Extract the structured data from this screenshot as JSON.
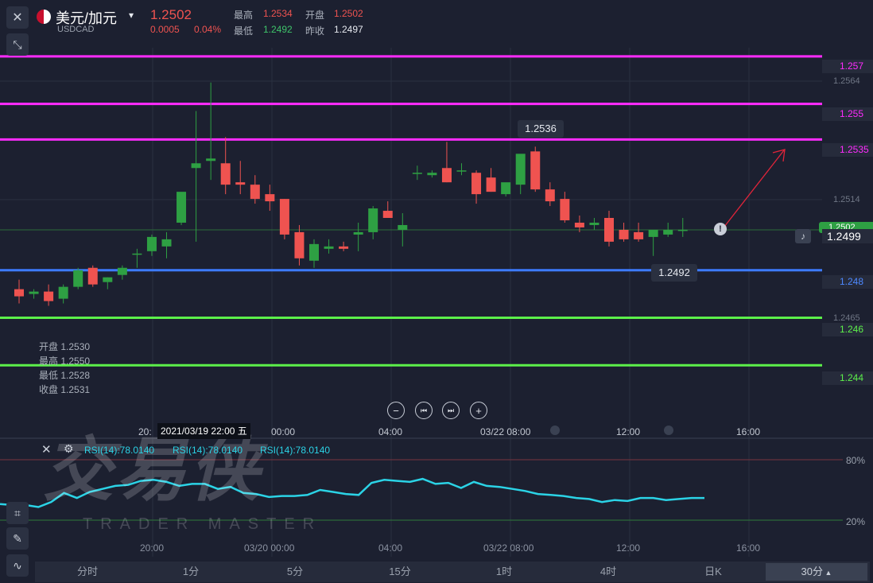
{
  "header": {
    "symbol": "美元/加元",
    "code": "USDCAD",
    "price": "1.2502",
    "change": "0.0005",
    "change_pct": "0.04%",
    "high_label": "最高",
    "high_value": "1.2534",
    "low_label": "最低",
    "low_value": "1.2492",
    "open_label": "开盘",
    "open_value": "1.2502",
    "prev_close_label": "昨收",
    "prev_close_value": "1.2497"
  },
  "levels": [
    {
      "label": "1.257",
      "color": "#ff2bff"
    },
    {
      "label": "1.255",
      "color": "#ff2bff"
    },
    {
      "label": "1.2535",
      "color": "#ff2bff"
    },
    {
      "label": "1.248",
      "color": "#3d7bff"
    },
    {
      "label": "1.246",
      "color": "#5cf04a"
    },
    {
      "label": "1.244",
      "color": "#5cf04a"
    }
  ],
  "price_axis": [
    "1.2564",
    "1.2514",
    "1.2465"
  ],
  "current_price_tag": "1.2502",
  "current_price_alert": "1.2499",
  "annotations": {
    "high_tip": "1.2536",
    "low_tip": "1.2492"
  },
  "ohlc_info": {
    "open": "开盘 1.2530",
    "high": "最高 1.2550",
    "low": "最低 1.2528",
    "close": "收盘 1.2531"
  },
  "crosshair_time": "2021/03/19 22:00 五",
  "time_axis": [
    "20:00",
    "03/20 00:00",
    "04:00",
    "03/22 08:00",
    "12:00",
    "16:00"
  ],
  "time_axis_main_partial": {
    "left": "20:",
    "mid_tail": "00:00"
  },
  "rsi": {
    "labels": [
      "RSI(14):78.0140",
      "RSI(14):78.0140",
      "RSI(14):78.0140"
    ],
    "level_high": "80%",
    "level_low": "20%",
    "values": [
      36,
      35,
      35,
      33,
      38,
      47,
      42,
      48,
      51,
      54,
      55,
      59,
      60,
      58,
      54,
      56,
      56,
      51,
      53,
      47,
      46,
      43,
      44,
      44,
      45,
      50,
      48,
      46,
      45,
      57,
      60,
      59,
      58,
      61,
      56,
      57,
      52,
      58,
      54,
      53,
      51,
      49,
      46,
      45,
      44,
      42,
      41,
      38,
      40,
      39,
      42,
      42,
      40,
      41,
      42,
      42
    ]
  },
  "watermark": {
    "text": "TRADER MASTER"
  },
  "tabs": [
    "分时",
    "1分",
    "5分",
    "15分",
    "1时",
    "4时",
    "日K",
    "30分"
  ],
  "active_tab_index": 7,
  "chart_data": {
    "type": "candlestick",
    "symbol": "USDCAD",
    "candles": [
      {
        "o": 1.2472,
        "h": 1.2476,
        "l": 1.2466,
        "c": 1.2469
      },
      {
        "o": 1.247,
        "h": 1.2472,
        "l": 1.2468,
        "c": 1.2471
      },
      {
        "o": 1.2471,
        "h": 1.2474,
        "l": 1.2465,
        "c": 1.2467
      },
      {
        "o": 1.2468,
        "h": 1.2474,
        "l": 1.2466,
        "c": 1.2473
      },
      {
        "o": 1.2473,
        "h": 1.2481,
        "l": 1.2472,
        "c": 1.248
      },
      {
        "o": 1.2481,
        "h": 1.2482,
        "l": 1.2473,
        "c": 1.2474
      },
      {
        "o": 1.2475,
        "h": 1.2477,
        "l": 1.2472,
        "c": 1.2477
      },
      {
        "o": 1.2478,
        "h": 1.2482,
        "l": 1.2476,
        "c": 1.2481
      },
      {
        "o": 1.2487,
        "h": 1.2489,
        "l": 1.2481,
        "c": 1.2487
      },
      {
        "o": 1.2488,
        "h": 1.2495,
        "l": 1.2486,
        "c": 1.2494
      },
      {
        "o": 1.249,
        "h": 1.2496,
        "l": 1.2485,
        "c": 1.2493
      },
      {
        "o": 1.25,
        "h": 1.2507,
        "l": 1.2499,
        "c": 1.2513
      },
      {
        "o": 1.2523,
        "h": 1.2547,
        "l": 1.2492,
        "c": 1.2525
      },
      {
        "o": 1.2526,
        "h": 1.2559,
        "l": 1.2518,
        "c": 1.2527
      },
      {
        "o": 1.2525,
        "h": 1.2536,
        "l": 1.2512,
        "c": 1.2516
      },
      {
        "o": 1.2517,
        "h": 1.2526,
        "l": 1.2512,
        "c": 1.2516
      },
      {
        "o": 1.2516,
        "h": 1.252,
        "l": 1.2508,
        "c": 1.251
      },
      {
        "o": 1.2512,
        "h": 1.2516,
        "l": 1.2505,
        "c": 1.2509
      },
      {
        "o": 1.251,
        "h": 1.251,
        "l": 1.2493,
        "c": 1.2495
      },
      {
        "o": 1.2496,
        "h": 1.2499,
        "l": 1.2482,
        "c": 1.2485
      },
      {
        "o": 1.2484,
        "h": 1.2493,
        "l": 1.2481,
        "c": 1.2491
      },
      {
        "o": 1.2489,
        "h": 1.2493,
        "l": 1.2487,
        "c": 1.249
      },
      {
        "o": 1.249,
        "h": 1.2492,
        "l": 1.2488,
        "c": 1.2489
      },
      {
        "o": 1.2495,
        "h": 1.25,
        "l": 1.2488,
        "c": 1.2496
      },
      {
        "o": 1.2496,
        "h": 1.2507,
        "l": 1.2493,
        "c": 1.2506
      },
      {
        "o": 1.2505,
        "h": 1.2509,
        "l": 1.2503,
        "c": 1.2502
      },
      {
        "o": 1.2497,
        "h": 1.2504,
        "l": 1.249,
        "c": 1.2499
      },
      {
        "o": 1.2521,
        "h": 1.2524,
        "l": 1.2518,
        "c": 1.2521
      },
      {
        "o": 1.252,
        "h": 1.2522,
        "l": 1.2519,
        "c": 1.2521
      },
      {
        "o": 1.2523,
        "h": 1.2534,
        "l": 1.2517,
        "c": 1.2517
      },
      {
        "o": 1.2522,
        "h": 1.2525,
        "l": 1.252,
        "c": 1.2522
      },
      {
        "o": 1.2521,
        "h": 1.2522,
        "l": 1.2508,
        "c": 1.2512
      },
      {
        "o": 1.2519,
        "h": 1.2523,
        "l": 1.2513,
        "c": 1.2513
      },
      {
        "o": 1.2512,
        "h": 1.2514,
        "l": 1.2511,
        "c": 1.2517
      },
      {
        "o": 1.2516,
        "h": 1.2524,
        "l": 1.2512,
        "c": 1.2529
      },
      {
        "o": 1.253,
        "h": 1.2532,
        "l": 1.2513,
        "c": 1.2514
      },
      {
        "o": 1.2514,
        "h": 1.2517,
        "l": 1.2507,
        "c": 1.2509
      },
      {
        "o": 1.251,
        "h": 1.2513,
        "l": 1.25,
        "c": 1.2501
      },
      {
        "o": 1.25,
        "h": 1.2503,
        "l": 1.2496,
        "c": 1.2498
      },
      {
        "o": 1.2499,
        "h": 1.2502,
        "l": 1.2497,
        "c": 1.25
      },
      {
        "o": 1.2502,
        "h": 1.2505,
        "l": 1.249,
        "c": 1.2492
      },
      {
        "o": 1.2497,
        "h": 1.25,
        "l": 1.2492,
        "c": 1.2493
      },
      {
        "o": 1.2496,
        "h": 1.25,
        "l": 1.2492,
        "c": 1.2493
      },
      {
        "o": 1.2494,
        "h": 1.2496,
        "l": 1.2486,
        "c": 1.2497
      },
      {
        "o": 1.2495,
        "h": 1.25,
        "l": 1.2494,
        "c": 1.2497
      },
      {
        "o": 1.2497,
        "h": 1.2502,
        "l": 1.2494,
        "c": 1.2497
      }
    ],
    "ylim": [
      1.2425,
      1.258
    ],
    "horizontal_levels": [
      1.257,
      1.255,
      1.2535,
      1.248,
      1.246,
      1.244
    ],
    "x_ticks": [
      "20:00",
      "03/20 00:00",
      "04:00",
      "03/22 08:00",
      "12:00",
      "16:00"
    ],
    "y_ticks": [
      1.2564,
      1.2514,
      1.2465
    ],
    "rsi_ylim": [
      0,
      100
    ],
    "rsi_levels": [
      80,
      20
    ]
  }
}
